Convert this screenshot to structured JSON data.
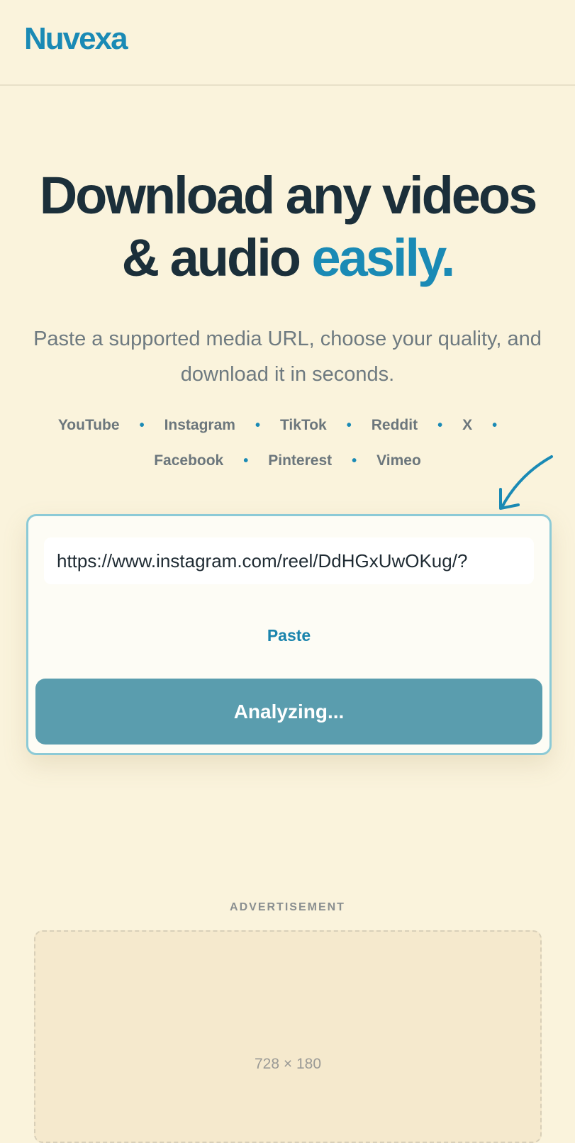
{
  "header": {
    "logo": "Nuvexa"
  },
  "hero": {
    "title_line1": "Download any videos",
    "title_line2_plain": "& audio ",
    "title_line2_accent": "easily.",
    "subtitle": "Paste a supported media URL, choose your quality, and download it in seconds."
  },
  "platforms": {
    "row1": [
      "YouTube",
      "Instagram",
      "TikTok",
      "Reddit",
      "X"
    ],
    "row2": [
      "Facebook",
      "Pinterest",
      "Vimeo"
    ],
    "separator": "•"
  },
  "form": {
    "url_value": "https://www.instagram.com/reel/DdHGxUwOKug/?",
    "paste_label": "Paste",
    "submit_label": "Analyzing..."
  },
  "ad": {
    "label": "ADVERTISEMENT",
    "size_text": "728 × 180"
  },
  "colors": {
    "background": "#faf3dc",
    "brand": "#1a8ab5",
    "button": "#5a9dae",
    "card_border": "#8ccad6"
  },
  "icons": {
    "arrow": "curved-arrow-icon"
  }
}
